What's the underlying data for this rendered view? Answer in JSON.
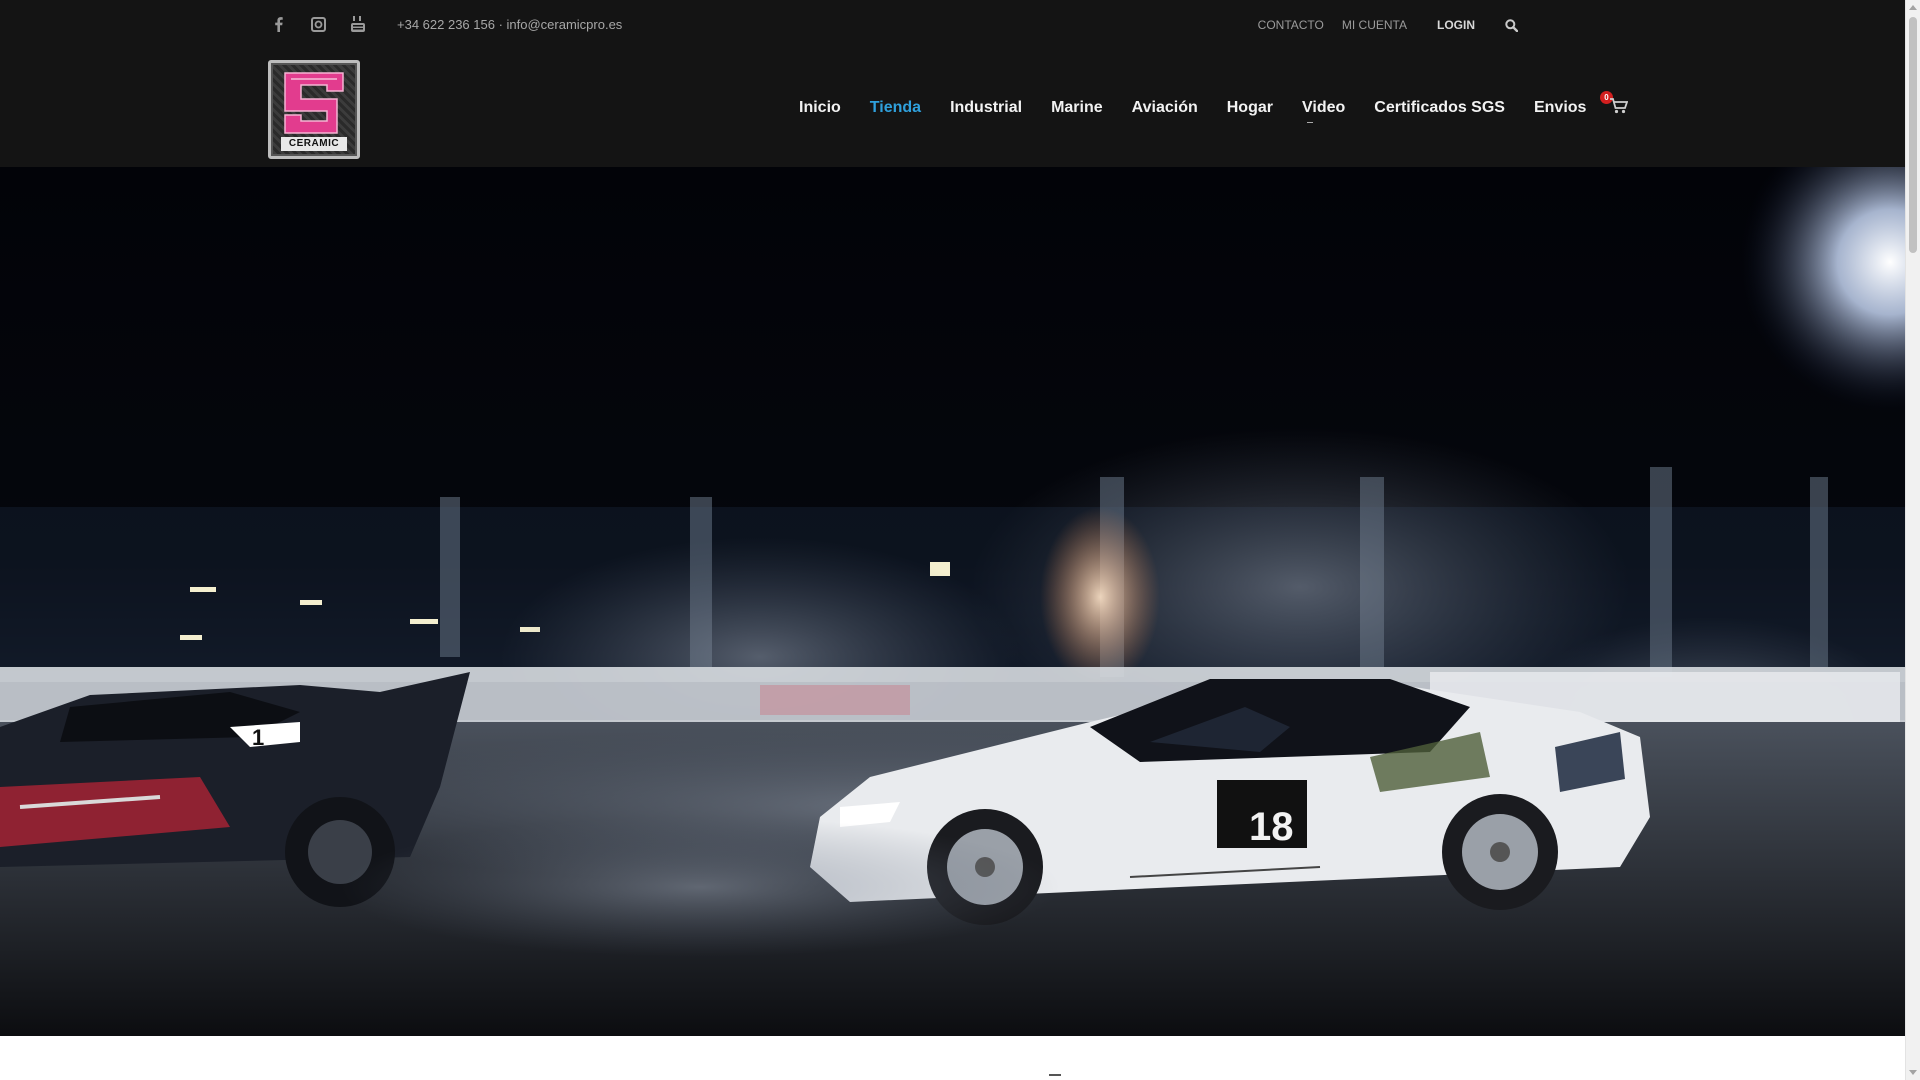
{
  "topbar": {
    "social": [
      {
        "name": "facebook-icon"
      },
      {
        "name": "instagram-icon"
      },
      {
        "name": "youtube-icon"
      }
    ],
    "contact": "+34 622 236 156 · info@ceramicpro.es",
    "links": {
      "contacto": "CONTACTO",
      "mi_cuenta": "MI CUENTA",
      "login": "LOGIN"
    }
  },
  "header": {
    "logo_text": "CERAMIC",
    "nav": [
      {
        "label": "Inicio",
        "active": false
      },
      {
        "label": "Tienda",
        "active": true
      },
      {
        "label": "Industrial",
        "active": false
      },
      {
        "label": "Marine",
        "active": false
      },
      {
        "label": "Aviación",
        "active": false
      },
      {
        "label": "Hogar",
        "active": false
      },
      {
        "label": "Video",
        "active": false
      },
      {
        "label": "Certificados SGS",
        "active": false
      },
      {
        "label": "Envios",
        "active": false
      }
    ],
    "cart_count": "0"
  },
  "hero": {
    "car_right_number": "18",
    "car_left_number": "1"
  },
  "colors": {
    "header_bg": "#141414",
    "accent": "#2fa0dc",
    "cart_badge": "#d21f1f"
  }
}
